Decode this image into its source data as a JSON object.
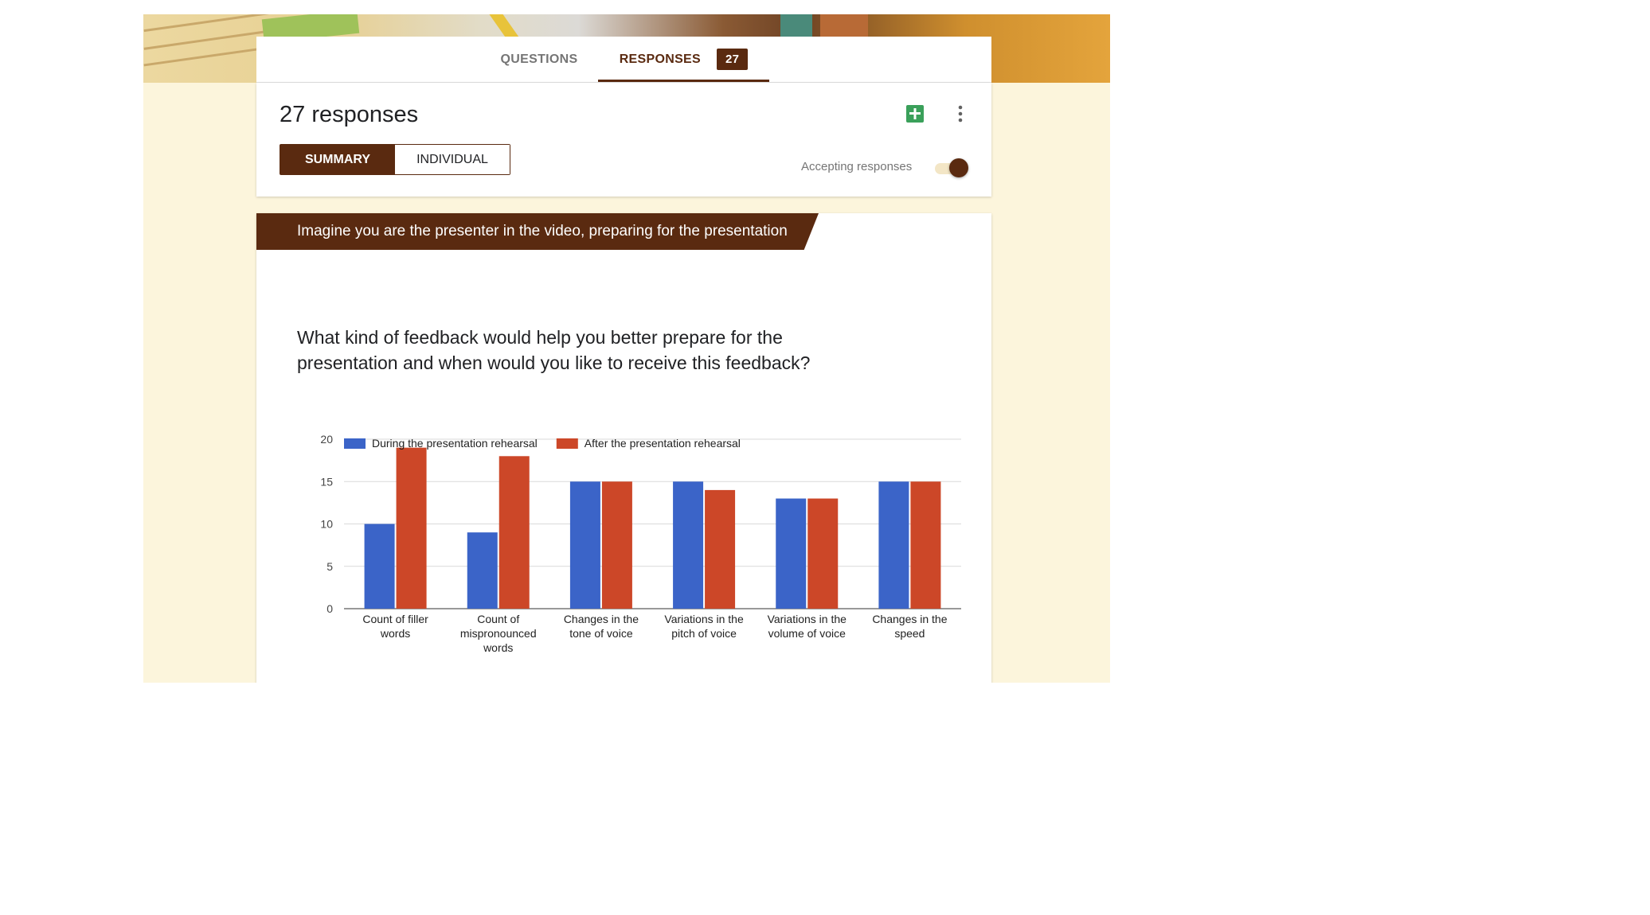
{
  "tabs": {
    "questions": "QUESTIONS",
    "responses": "RESPONSES",
    "responses_count": "27"
  },
  "summary": {
    "title": "27 responses",
    "view_toggle": {
      "summary": "SUMMARY",
      "individual": "INDIVIDUAL"
    },
    "accepting_label": "Accepting responses",
    "accepting": true,
    "icons": {
      "sheets": "sheets-icon",
      "menu": "more-vert-icon"
    }
  },
  "section": {
    "title": "Imagine you are the presenter in the video, preparing for the presentation"
  },
  "question": {
    "text": "What kind of feedback would help you better prepare for the presentation and when would you like to receive this feedback?"
  },
  "colors": {
    "brand": "#5a2a10",
    "series_blue": "#3b64c8",
    "series_red": "#cc4728",
    "sheets_green": "#3aa05a"
  },
  "chart_data": {
    "type": "bar",
    "categories": [
      [
        "Count of filler",
        "words"
      ],
      [
        "Count of",
        "mispronounced",
        "words"
      ],
      [
        "Changes in the",
        "tone of voice"
      ],
      [
        "Variations in the",
        "pitch of voice"
      ],
      [
        "Variations in the",
        "volume of voice"
      ],
      [
        "Changes in the",
        "speed"
      ]
    ],
    "series": [
      {
        "name": "During the presentation rehearsal",
        "color": "#3b64c8",
        "values": [
          10,
          9,
          15,
          15,
          13,
          15
        ]
      },
      {
        "name": "After the presentation rehearsal",
        "color": "#cc4728",
        "values": [
          19,
          18,
          15,
          14,
          13,
          15
        ]
      }
    ],
    "yticks": [
      0,
      5,
      10,
      15,
      20
    ],
    "ylim": [
      0,
      20
    ],
    "grid": true,
    "legend": "top-left"
  }
}
